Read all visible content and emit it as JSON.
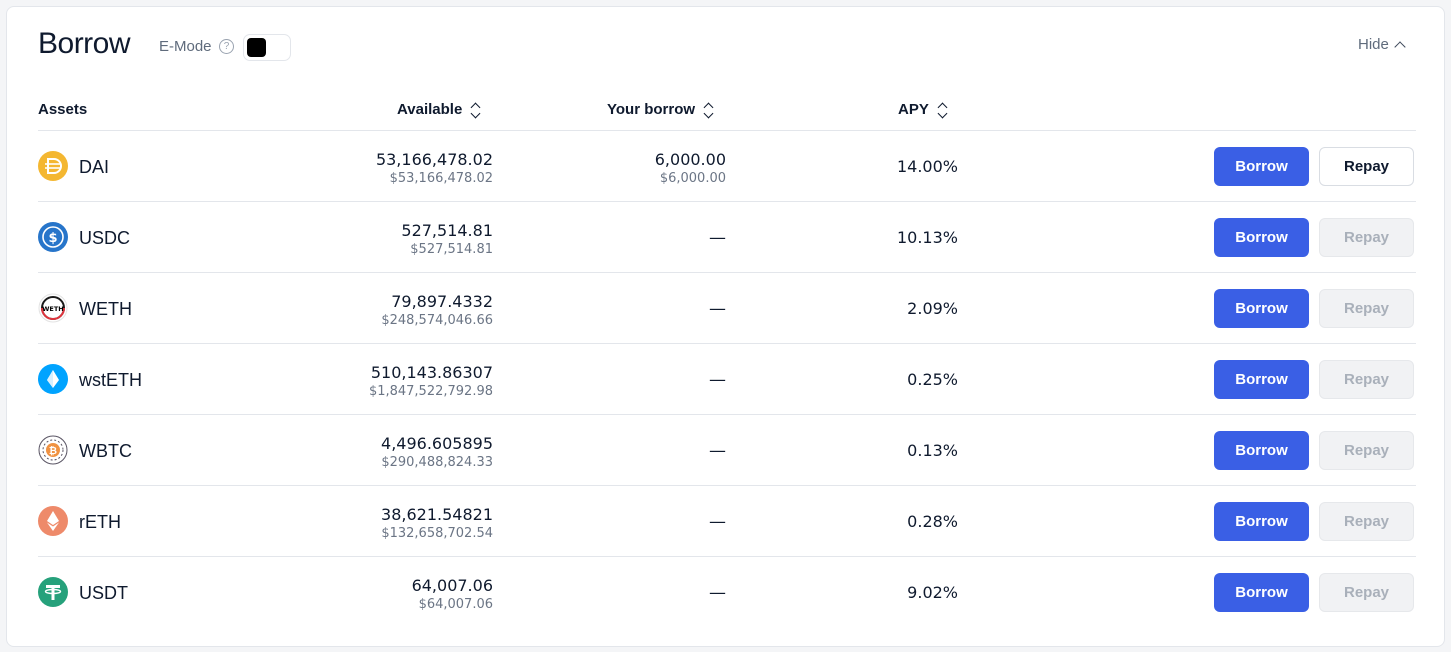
{
  "header": {
    "title": "Borrow",
    "emode_label": "E-Mode",
    "help_glyph": "?",
    "hide_label": "Hide"
  },
  "columns": {
    "assets": "Assets",
    "available": "Available",
    "your_borrow": "Your borrow",
    "apy": "APY"
  },
  "colors": {
    "accent": "#3a5fe5",
    "dai": "#f4b731",
    "usdc": "#2775ca",
    "weth": "#1a1a1a",
    "wsteth": "#00a3ff",
    "wbtc": "#f09242",
    "reth": "#ee8a6a",
    "usdt": "#26a17b"
  },
  "assets": [
    {
      "name": "DAI",
      "icon": "dai-icon",
      "available": "53,166,478.02",
      "available_usd": "$53,166,478.02",
      "borrow": "6,000.00",
      "borrow_usd": "$6,000.00",
      "apy": "14.00%",
      "borrow_label": "Borrow",
      "repay_label": "Repay",
      "repay_enabled": true
    },
    {
      "name": "USDC",
      "icon": "usdc-icon",
      "available": "527,514.81",
      "available_usd": "$527,514.81",
      "borrow": "—",
      "borrow_usd": "",
      "apy": "10.13%",
      "borrow_label": "Borrow",
      "repay_label": "Repay",
      "repay_enabled": false
    },
    {
      "name": "WETH",
      "icon": "weth-icon",
      "icon_text": "WETH",
      "available": "79,897.4332",
      "available_usd": "$248,574,046.66",
      "borrow": "—",
      "borrow_usd": "",
      "apy": "2.09%",
      "borrow_label": "Borrow",
      "repay_label": "Repay",
      "repay_enabled": false
    },
    {
      "name": "wstETH",
      "icon": "wsteth-icon",
      "available": "510,143.86307",
      "available_usd": "$1,847,522,792.98",
      "borrow": "—",
      "borrow_usd": "",
      "apy": "0.25%",
      "borrow_label": "Borrow",
      "repay_label": "Repay",
      "repay_enabled": false
    },
    {
      "name": "WBTC",
      "icon": "wbtc-icon",
      "available": "4,496.605895",
      "available_usd": "$290,488,824.33",
      "borrow": "—",
      "borrow_usd": "",
      "apy": "0.13%",
      "borrow_label": "Borrow",
      "repay_label": "Repay",
      "repay_enabled": false
    },
    {
      "name": "rETH",
      "icon": "reth-icon",
      "available": "38,621.54821",
      "available_usd": "$132,658,702.54",
      "borrow": "—",
      "borrow_usd": "",
      "apy": "0.28%",
      "borrow_label": "Borrow",
      "repay_label": "Repay",
      "repay_enabled": false
    },
    {
      "name": "USDT",
      "icon": "usdt-icon",
      "available": "64,007.06",
      "available_usd": "$64,007.06",
      "borrow": "—",
      "borrow_usd": "",
      "apy": "9.02%",
      "borrow_label": "Borrow",
      "repay_label": "Repay",
      "repay_enabled": false
    }
  ]
}
